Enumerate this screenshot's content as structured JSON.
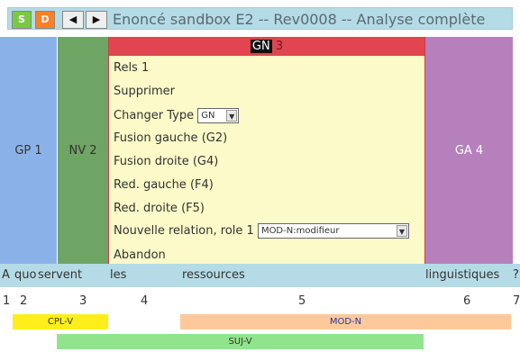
{
  "toolbar": {
    "s_label": "S",
    "d_label": "D",
    "prev_label": "◀",
    "next_label": "▶",
    "title": "Enoncé sandbox E2 -- Rev0008 -- Analyse complète"
  },
  "columns": {
    "gp1": "GP 1",
    "nv2": "NV 2",
    "ga4": "GA 4"
  },
  "gn_panel": {
    "label": "GN",
    "number": "3",
    "items": {
      "rels": "Rels 1",
      "supprimer": "Supprimer",
      "changer_type": "Changer Type",
      "changer_type_value": "GN",
      "fusion_gauche": "Fusion gauche (G2)",
      "fusion_droite": "Fusion droite (G4)",
      "red_gauche": "Red. gauche (F4)",
      "red_droite": "Red. droite (F5)",
      "nouvelle_relation": "Nouvelle relation, role 1",
      "nouvelle_relation_value": "MOD-N:modifieur",
      "abandon": "Abandon"
    }
  },
  "words": [
    "A",
    "quoi",
    "servent",
    "les",
    "ressources",
    "linguistiques",
    "?"
  ],
  "indices": [
    "1",
    "2",
    "3",
    "4",
    "5",
    "6",
    "7"
  ],
  "relations": {
    "cpl_v": "CPL-V",
    "mod_n": "MOD-N",
    "suj_v": "SUJ-V"
  },
  "colors": {
    "toolbar_bg": "#b4dbe6",
    "gp": "#8bb2e8",
    "nv": "#6ea564",
    "gn_header": "#e04550",
    "gn_panel": "#fbfac8",
    "ga": "#b680bd",
    "cpl_v": "#ffee19",
    "mod_n": "#fdc99b",
    "suj_v": "#90e48c"
  }
}
